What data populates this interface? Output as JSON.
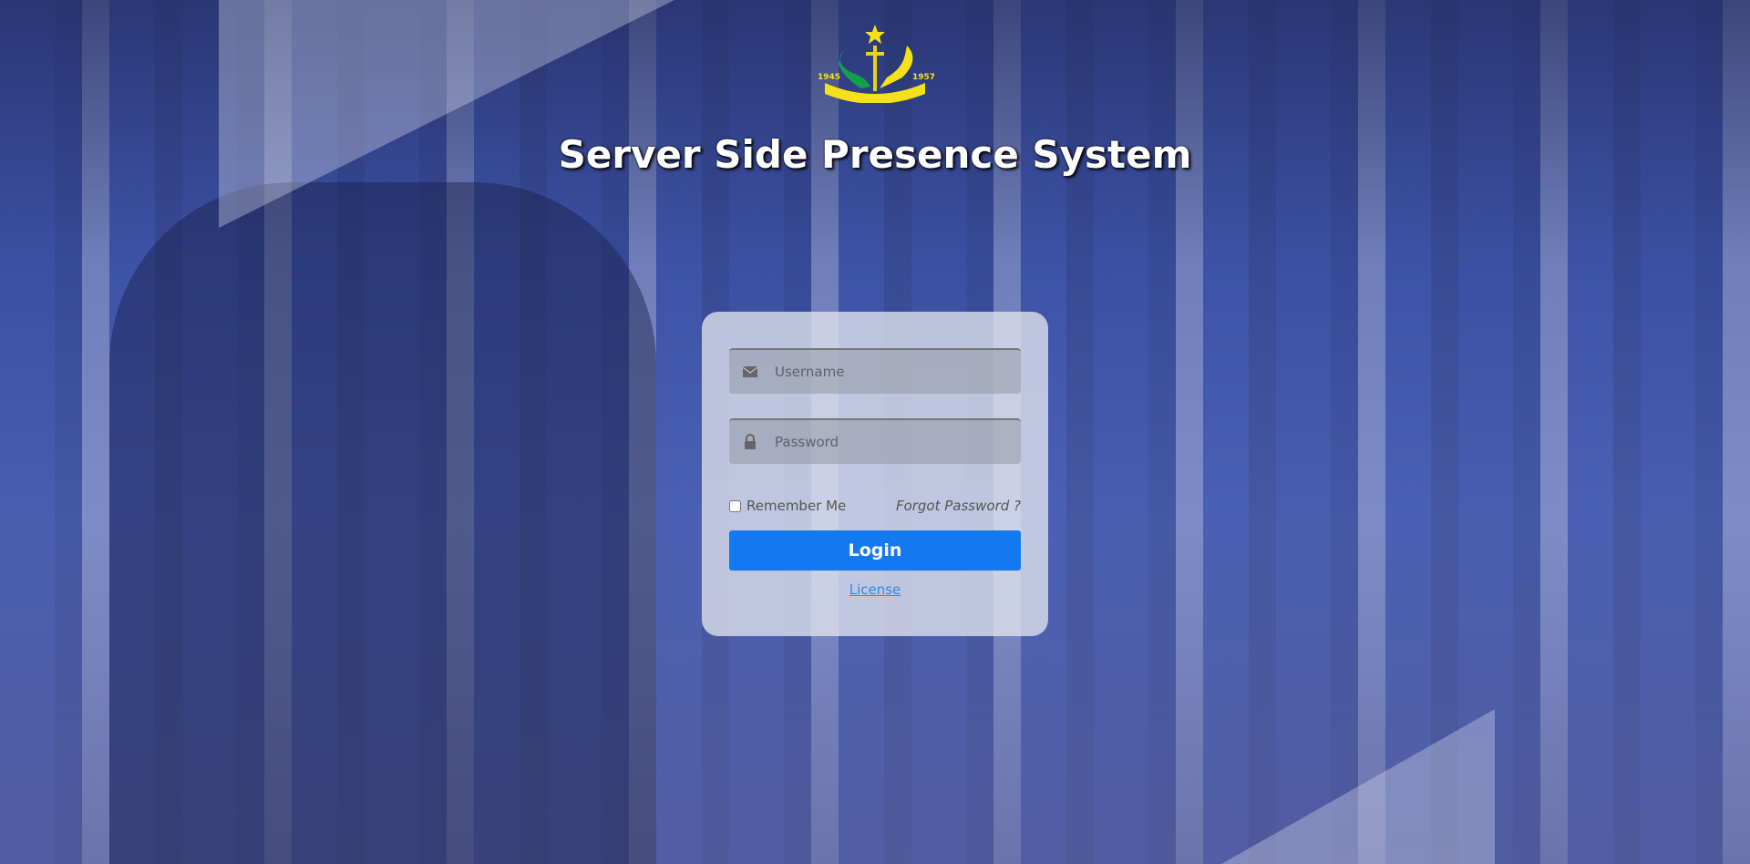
{
  "logo": {
    "year_left": "1945",
    "year_right": "1957"
  },
  "header": {
    "title": "Server Side Presence System"
  },
  "login_form": {
    "username_placeholder": "Username",
    "password_placeholder": "Password",
    "remember_label": "Remember Me",
    "forgot_label": "Forgot Password ?",
    "login_label": "Login",
    "license_label": "License"
  },
  "colors": {
    "accent": "#1479ee",
    "link": "#2a8de8"
  }
}
